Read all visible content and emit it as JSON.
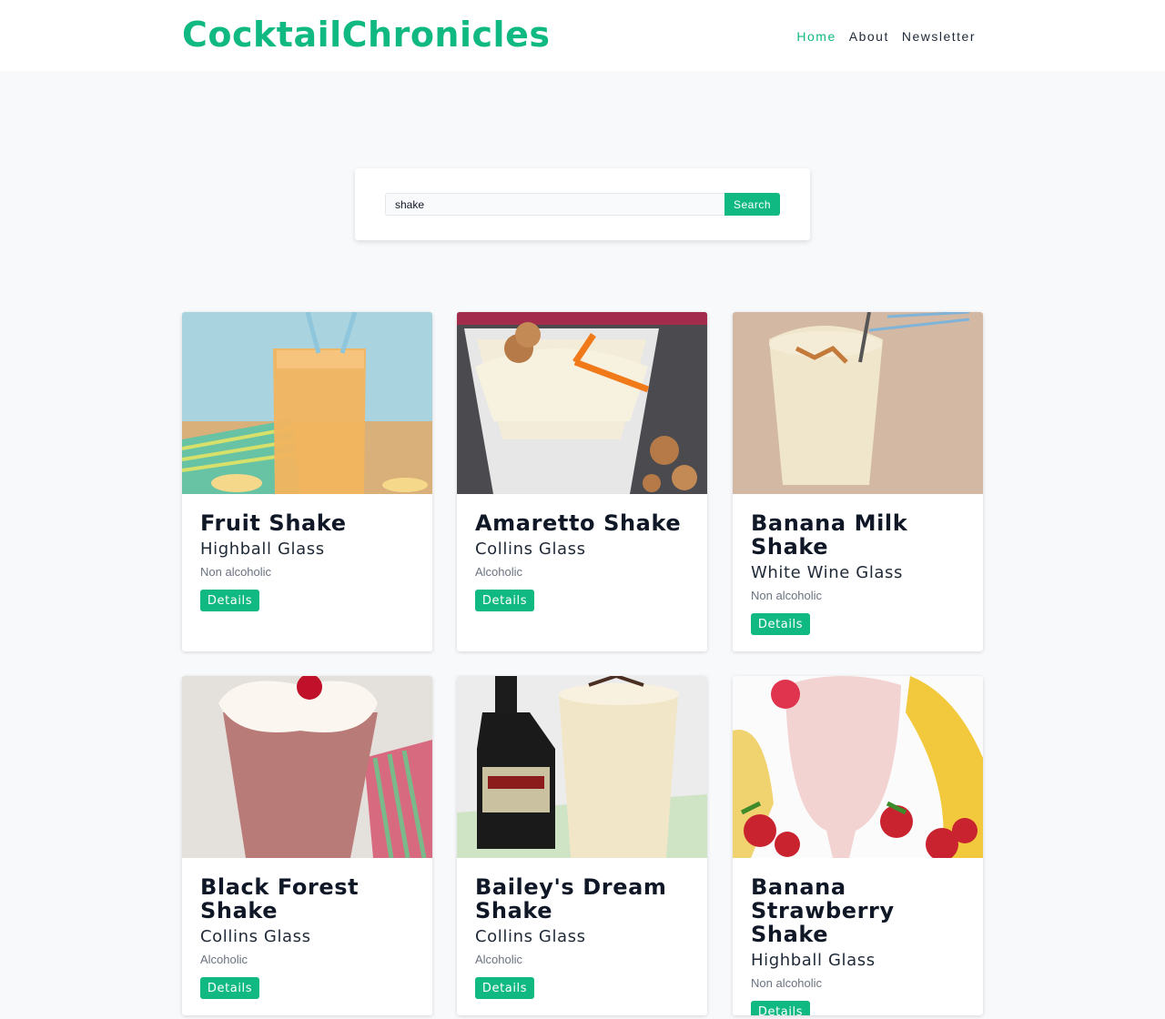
{
  "header": {
    "logo": "CocktailChronicles",
    "nav": [
      {
        "label": "Home",
        "active": true
      },
      {
        "label": "About",
        "active": false
      },
      {
        "label": "Newsletter",
        "active": false
      }
    ]
  },
  "search": {
    "value": "shake",
    "button_label": "Search"
  },
  "cards": [
    {
      "name": "Fruit Shake",
      "glass": "Highball Glass",
      "type": "Non alcoholic",
      "button": "Details"
    },
    {
      "name": "Amaretto Shake",
      "glass": "Collins Glass",
      "type": "Alcoholic",
      "button": "Details"
    },
    {
      "name": "Banana Milk Shake",
      "glass": "White Wine Glass",
      "type": "Non alcoholic",
      "button": "Details"
    },
    {
      "name": "Black Forest Shake",
      "glass": "Collins Glass",
      "type": "Alcoholic",
      "button": "Details"
    },
    {
      "name": "Bailey's Dream Shake",
      "glass": "Collins Glass",
      "type": "Alcoholic",
      "button": "Details"
    },
    {
      "name": "Banana Strawberry Shake",
      "glass": "Highball Glass",
      "type": "Non alcoholic",
      "button": "Details"
    }
  ],
  "colors": {
    "accent": "#10b981",
    "background": "#f8f9fb",
    "text": "#101828",
    "muted": "#6b7280"
  }
}
